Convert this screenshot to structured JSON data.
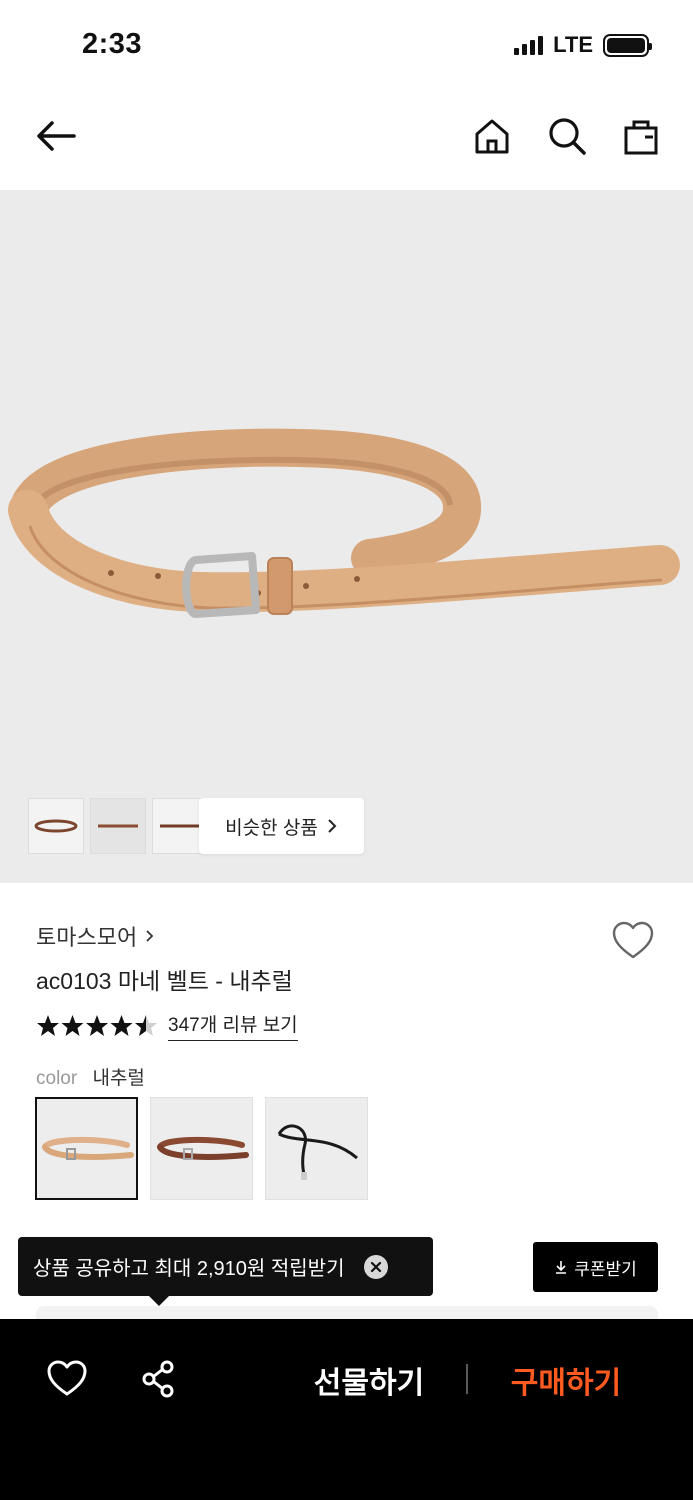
{
  "status": {
    "time": "2:33",
    "network": "LTE"
  },
  "header": {
    "back_icon": "arrow-left-icon",
    "home_icon": "home-icon",
    "search_icon": "search-icon",
    "cart_icon": "shopping-bag-icon"
  },
  "gallery": {
    "thumbnail_count": 3,
    "active_thumbnail": 2,
    "similar_label": "비슷한 상품"
  },
  "product": {
    "brand": "토마스모어",
    "name": "ac0103 마네 벨트 - 내추럴",
    "rating": 4.5,
    "review_link": "347개 리뷰 보기",
    "color_label": "color",
    "color_value": "내추럴",
    "swatches": [
      {
        "color": "#d9a77a",
        "selected": true
      },
      {
        "color": "#7b3f2b",
        "selected": false
      },
      {
        "color": "#1a1a1a",
        "selected": false
      }
    ]
  },
  "promo": {
    "tooltip": "상품 공유하고 최대 2,910원 적립받기",
    "coupon_label": "쿠폰받기"
  },
  "bottom_bar": {
    "gift_label": "선물하기",
    "buy_label": "구매하기",
    "buy_color": "#ff5a1f"
  }
}
